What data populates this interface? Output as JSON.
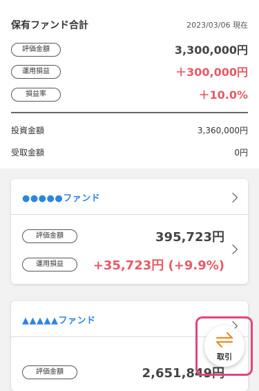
{
  "summary": {
    "title": "保有ファンド合計",
    "date": "2023/03/06 現在",
    "rows": [
      {
        "label": "評価金額",
        "value": "3,300,000円"
      },
      {
        "label": "運用損益",
        "value": "＋300,000円"
      },
      {
        "label": "損益率",
        "value": "＋10.0%"
      }
    ],
    "investment": {
      "label": "投資金額",
      "value": "3,360,000円"
    },
    "received": {
      "label": "受取金額",
      "value": "0円"
    }
  },
  "funds": [
    {
      "name": "●●●●●ファンド",
      "valuation_label": "評価金額",
      "valuation": "395,723円",
      "pnl_label": "運用損益",
      "pnl": "+35,723円 (+9.9%)"
    },
    {
      "name": "▲▲▲▲▲ファンド",
      "valuation_label": "評価金額",
      "valuation": "2,651,849円"
    }
  ],
  "fab": {
    "label": "取引"
  },
  "colors": {
    "accent_blue": "#2b86e0",
    "profit_red": "#e65a67",
    "fab_orange": "#f08a1c",
    "highlight_pink": "#e0457d"
  }
}
